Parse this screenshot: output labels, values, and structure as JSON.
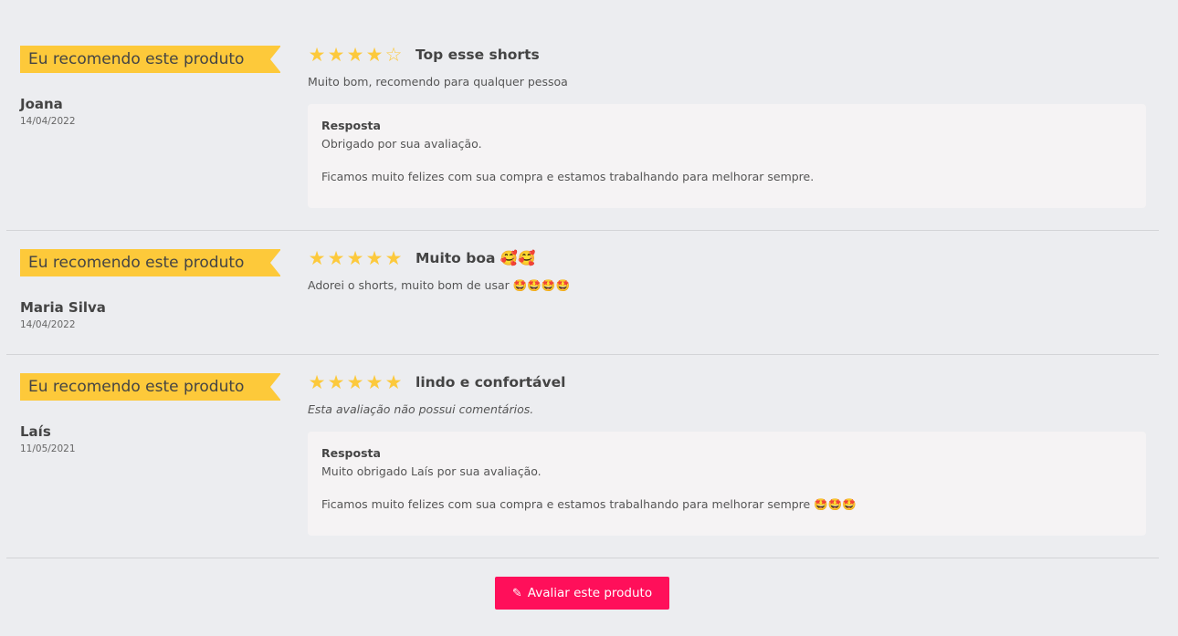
{
  "reviews": [
    {
      "badge": "Eu recomendo este produto",
      "author": "Joana",
      "date": "14/04/2022",
      "rating": 4,
      "title": "Top esse shorts",
      "body": "Muito bom, recomendo para qualquer pessoa",
      "reply": {
        "label": "Resposta",
        "line1": "Obrigado por sua avaliação.",
        "line2": "Ficamos muito felizes com sua compra e estamos trabalhando para melhorar sempre."
      }
    },
    {
      "badge": "Eu recomendo este produto",
      "author": "Maria Silva",
      "date": "14/04/2022",
      "rating": 5,
      "title": "Muito boa 🥰🥰",
      "body": "Adorei o shorts, muito bom de usar 🤩🤩🤩🤩"
    },
    {
      "badge": "Eu recomendo este produto",
      "author": "Laís",
      "date": "11/05/2021",
      "rating": 5,
      "title": "lindo e confortável",
      "body": "Esta avaliação não possui comentários.",
      "reply": {
        "label": "Resposta",
        "line1": "Muito obrigado Laís por sua avaliação.",
        "line2": "Ficamos muito felizes com sua compra e estamos trabalhando para melhorar sempre 🤩🤩🤩"
      }
    }
  ],
  "cta": {
    "label": "Avaliar este produto",
    "icon": "edit-icon"
  },
  "colors": {
    "badge": "#fdc93a",
    "star": "#fcc93c",
    "cta": "#ff0f5a",
    "background": "#ecedf0"
  }
}
